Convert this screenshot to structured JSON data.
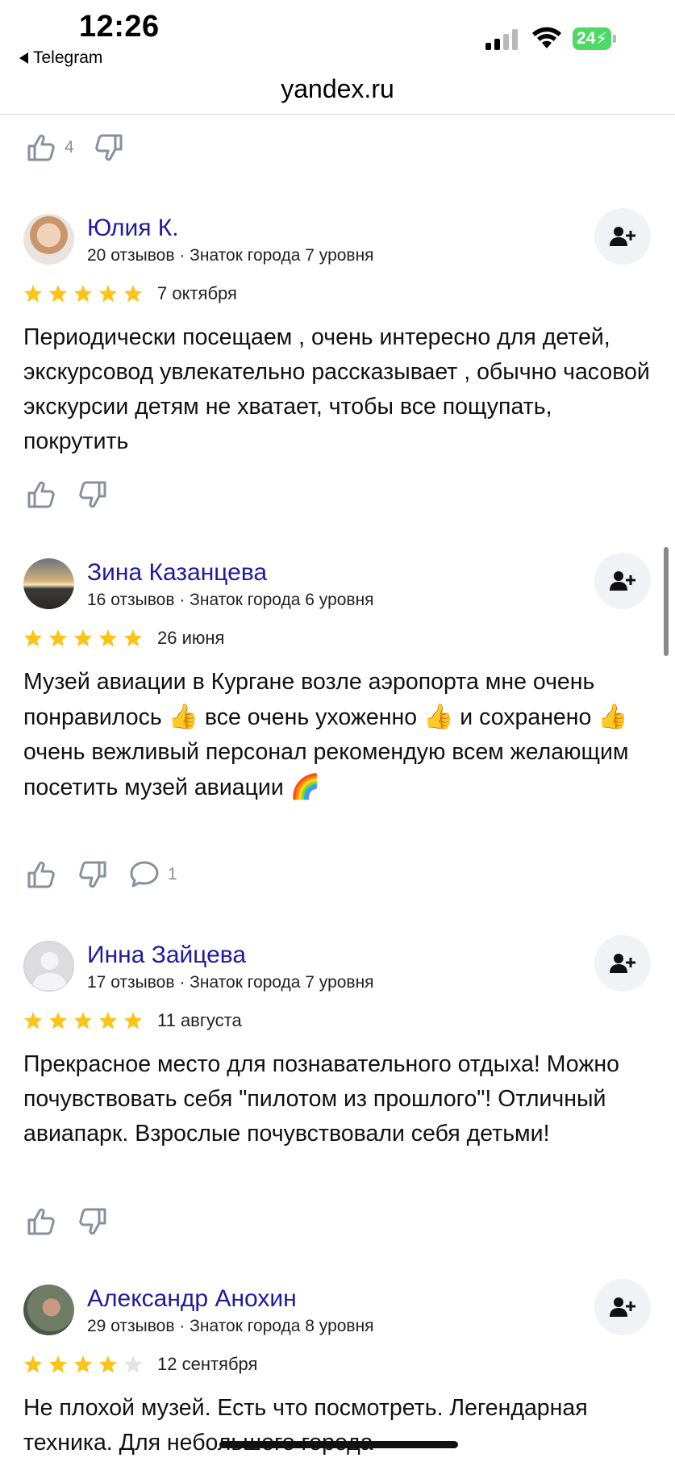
{
  "status": {
    "time": "12:26",
    "back_app": "Telegram",
    "battery": "24"
  },
  "browser": {
    "url": "yandex.ru"
  },
  "colors": {
    "author": "#1f1aa0",
    "star": "#fcc419",
    "star_empty": "#e3e3e6",
    "reaction": "#8a8f9e"
  },
  "top_reactions": {
    "likes": "4"
  },
  "reviews": [
    {
      "author": "Юлия К.",
      "meta": "20 отзывов · Знаток города 7 уровня",
      "rating": 5,
      "date": "7 октября",
      "text": "Периодически посещаем , очень интересно для детей, экскурсовод увлекательно рассказывает , обычно часовой экскурсии детям не хватает, чтобы все пощупать, покрутить",
      "comments": ""
    },
    {
      "author": "Зина Казанцева",
      "meta": "16 отзывов · Знаток города 6 уровня",
      "rating": 5,
      "date": "26 июня",
      "text_parts": [
        "Музей авиации в Кургане возле аэропорта мне очень понравилось ",
        "👍",
        " все очень ухоженно ",
        "👍",
        " и сохранено ",
        "👍",
        " очень вежливый персонал рекомендую всем желающим посетить музей авиации ",
        "🌈"
      ],
      "comments": "1"
    },
    {
      "author": "Инна Зайцева",
      "meta": "17 отзывов · Знаток города 7 уровня",
      "rating": 5,
      "date": "11 августа",
      "text": "Прекрасное место для познавательного отдыха! Можно почувствовать себя \"пилотом из прошлого\"! Отличный авиапарк. Взрослые почувствовали себя детьми!",
      "comments": ""
    },
    {
      "author": "Александр Анохин",
      "meta": "29 отзывов · Знаток города 8 уровня",
      "rating": 4,
      "date": "12 сентября",
      "text": "Не плохой музей. Есть что посмотреть. Легендарная техника. Для небольшого города",
      "comments": ""
    }
  ]
}
